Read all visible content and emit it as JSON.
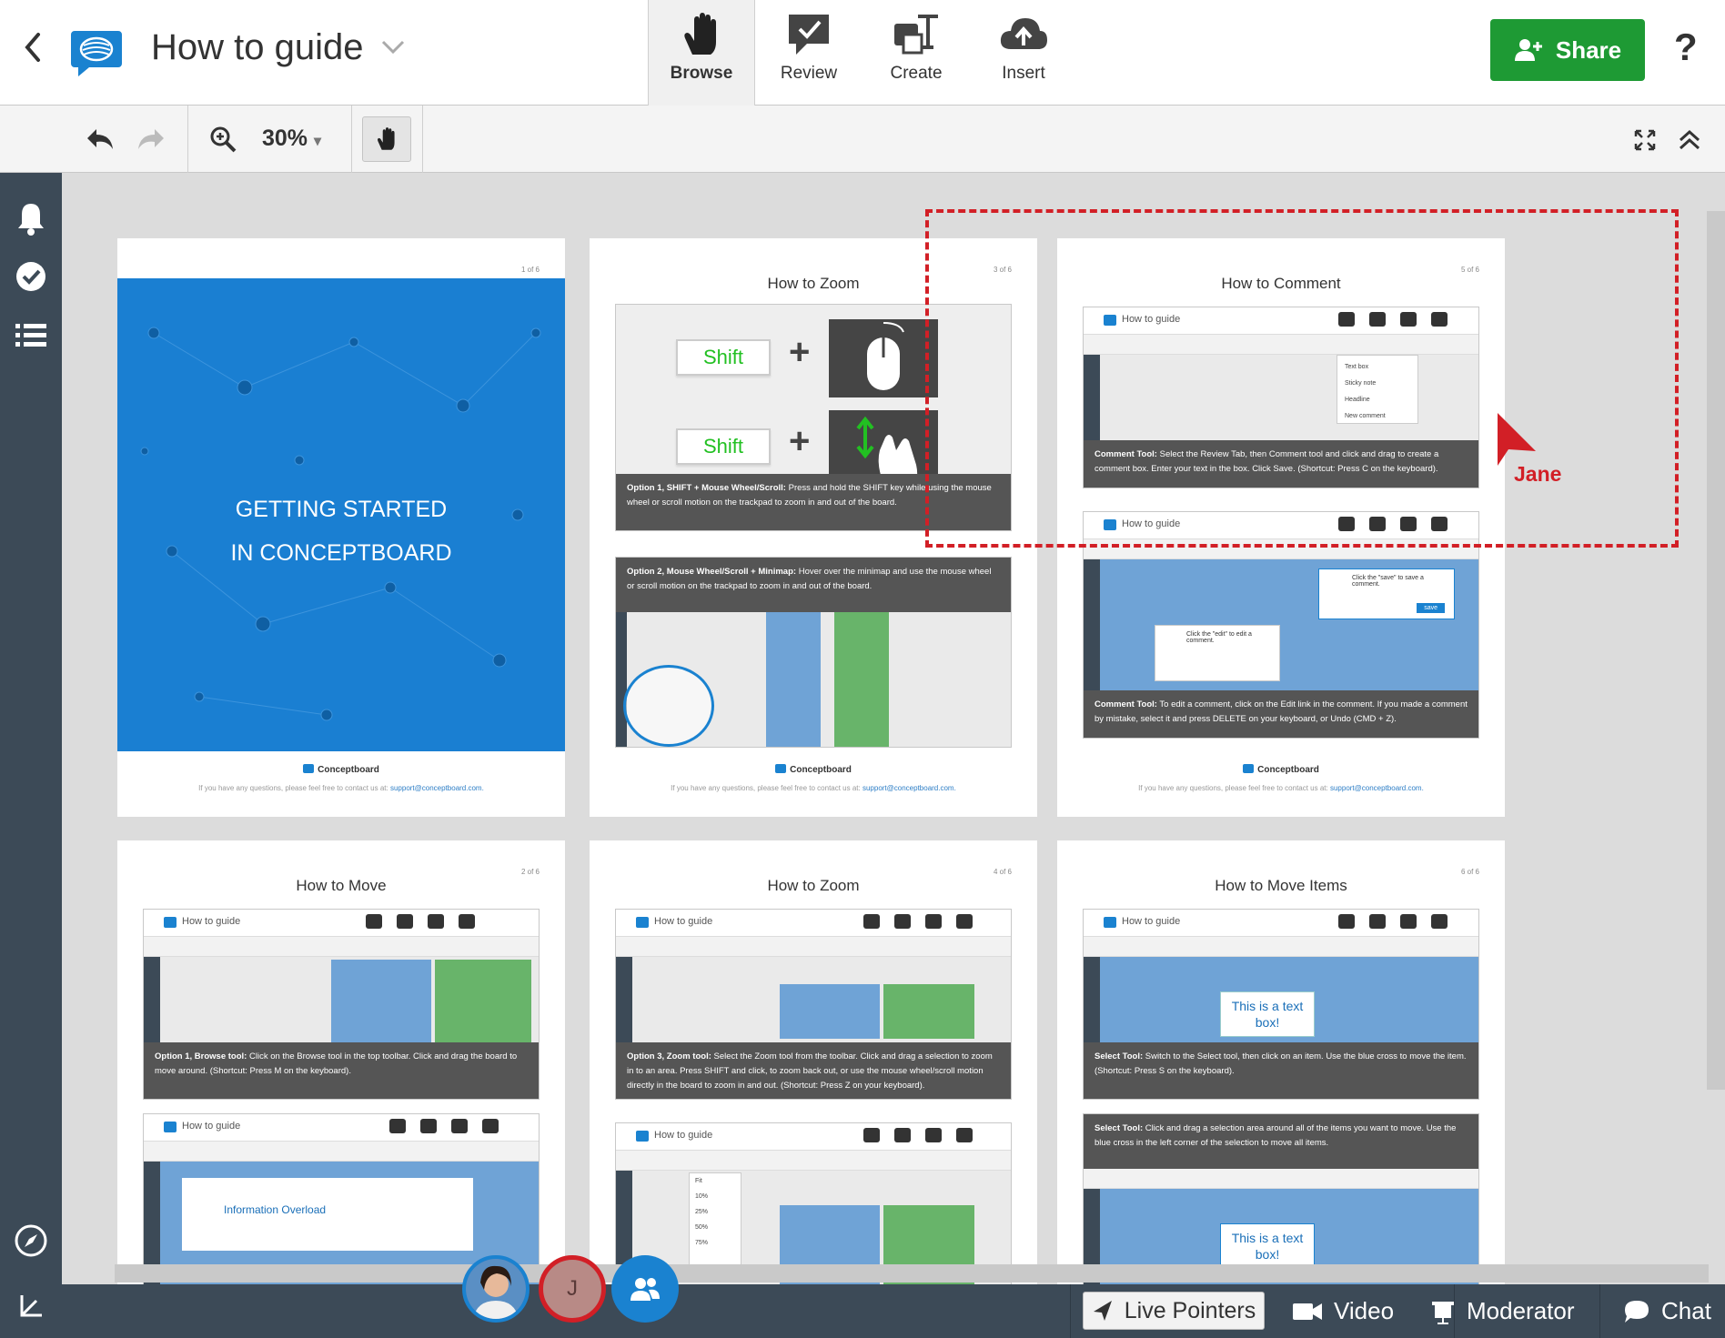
{
  "header": {
    "title": "How to guide",
    "modes": [
      {
        "label": "Browse",
        "icon": "hand-icon"
      },
      {
        "label": "Review",
        "icon": "comment-check-icon"
      },
      {
        "label": "Create",
        "icon": "shapes-text-icon"
      },
      {
        "label": "Insert",
        "icon": "cloud-upload-icon"
      }
    ],
    "share_label": "Share",
    "help_label": "?"
  },
  "toolbar": {
    "zoom": "30%",
    "zoom_caret": "▾"
  },
  "pages": {
    "p1": {
      "num": "1 of 6",
      "cover_line1": "GETTING STARTED",
      "cover_line2": "IN CONCEPTBOARD"
    },
    "p3": {
      "num": "3 of 6",
      "title": "How to Zoom",
      "key1": "Shift",
      "key2": "Shift",
      "cap1_bold": "Option 1, SHIFT + Mouse Wheel/Scroll:",
      "cap1_text": " Press and hold the SHIFT key while using the mouse wheel or scroll motion on the trackpad to zoom in and out of the board.",
      "cap2_bold": "Option 2, Mouse Wheel/Scroll + Minimap:",
      "cap2_text": " Hover over the minimap and use the mouse wheel or scroll motion on the trackpad to zoom in and out of the board."
    },
    "p5": {
      "num": "5 of 6",
      "title": "How to Comment",
      "shot_title": "How to guide",
      "menu": [
        "Text box",
        "Sticky note",
        "Headline",
        "New comment"
      ],
      "cap1_bold": "Comment Tool:",
      "cap1_text": " Select the Review Tab, then Comment tool and click and drag to create a comment box. Enter your text in the box. Click Save. (Shortcut: Press C on the keyboard).",
      "bubble1": "Click the \"save\" to save a comment.",
      "bubble2": "Click the \"edit\" to edit a comment.",
      "save_btn": "save",
      "cap2_bold": "Comment Tool:",
      "cap2_text": " To edit a comment, click on the Edit link in the comment. If you made a comment by mistake, select it and press DELETE on your keyboard, or Undo (CMD + Z)."
    },
    "p2": {
      "num": "2 of 6",
      "title": "How to Move",
      "shot_title": "How to guide",
      "cap1_bold": "Option 1, Browse tool:",
      "cap1_text": " Click on the Browse tool in the top toolbar. Click and drag the board to move around. (Shortcut: Press M on the keyboard).",
      "info": "Information Overload"
    },
    "p4": {
      "num": "4 of 6",
      "title": "How to Zoom",
      "shot_title": "How to guide",
      "cap1_bold": "Option 3, Zoom tool:",
      "cap1_text": " Select the Zoom tool from the toolbar. Click and drag a selection to zoom in to an area. Press SHIFT and click, to zoom back out, or use the mouse wheel/scroll motion directly in the board to zoom in and out. (Shortcut: Press Z on your keyboard).",
      "zoom_opts": [
        "Fit",
        "10%",
        "25%",
        "50%",
        "75%"
      ]
    },
    "p6": {
      "num": "6 of 6",
      "title": "How to Move Items",
      "shot_title": "How to guide",
      "textbox": "This is a text box!",
      "cap1_bold": "Select Tool:",
      "cap1_text": " Switch to the Select tool, then click on an item. Use the blue cross to move the item. (Shortcut: Press S on the keyboard).",
      "cap2_bold": "Select Tool:",
      "cap2_text": " Click and drag a selection area around all of the items you want to move. Use the blue cross in the left corner of the selection to move all items.",
      "textbox2": "This is a text box!"
    },
    "footer_brand": "Conceptboard",
    "footer_text_pre": "If you have any questions, please feel free to contact us at: ",
    "footer_email": "support@conceptboard.com."
  },
  "pointer": {
    "user": "Jane",
    "color": "#d21f26"
  },
  "collab": {
    "avatar2_initial": "J"
  },
  "bottom": {
    "live_pointers": "Live Pointers",
    "video": "Video",
    "moderator": "Moderator",
    "chat": "Chat"
  },
  "colors": {
    "brand_blue": "#1a7fd2",
    "share_green": "#1e9a34",
    "sidebar": "#3c4a57"
  }
}
